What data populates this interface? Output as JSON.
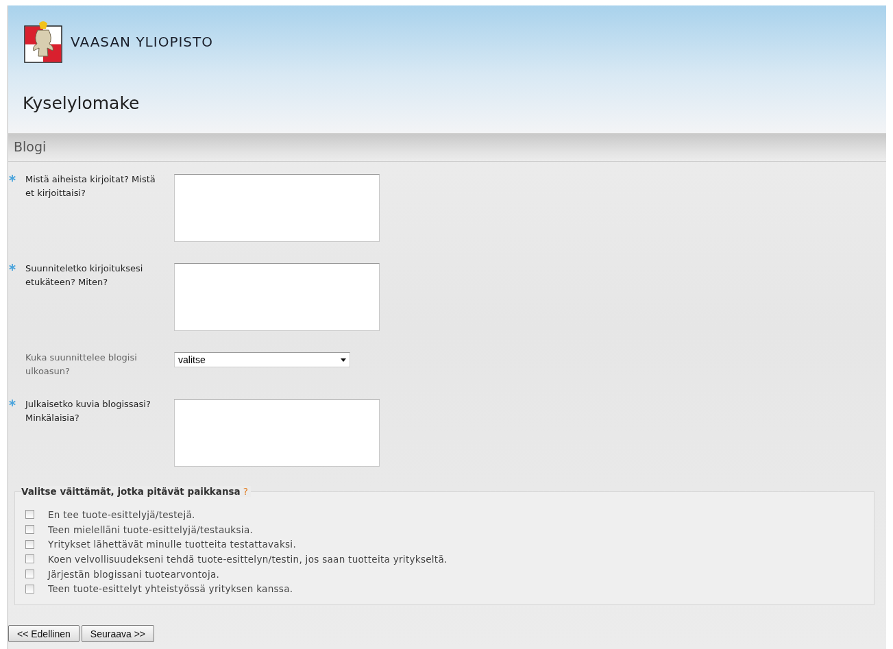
{
  "header": {
    "brand": "VAASAN YLIOPISTO",
    "title": "Kyselylomake"
  },
  "section": {
    "title": "Blogi"
  },
  "questions": [
    {
      "kind": "textarea",
      "required": true,
      "label": "Mistä aiheista kirjoitat? Mistä et kirjoittaisi?"
    },
    {
      "kind": "textarea",
      "required": true,
      "label": "Suunniteletko kirjoituksesi etukäteen? Miten?"
    },
    {
      "kind": "select",
      "required": false,
      "label": "Kuka suunnittelee blogisi ulkoasun?",
      "value": "valitse"
    },
    {
      "kind": "textarea",
      "required": true,
      "label": "Julkaisetko kuvia blogissasi? Minkälaisia?"
    }
  ],
  "statements": {
    "legend": "Valitse väittämät, jotka pitävät paikkansa",
    "help": "?",
    "items": [
      {
        "label": "En tee tuote-esittelyjä/testejä.",
        "checked": false
      },
      {
        "label": "Teen mielelläni tuote-esittelyjä/testauksia.",
        "checked": false
      },
      {
        "label": "Yritykset lähettävät minulle tuotteita testattavaksi.",
        "checked": false
      },
      {
        "label": "Koen velvollisuudekseni tehdä tuote-esittelyn/testin, jos saan tuotteita yritykseltä.",
        "checked": false
      },
      {
        "label": "Järjestän blogissani tuotearvontoja.",
        "checked": false
      },
      {
        "label": "Teen tuote-esittelyt yhteistyössä yrityksen kanssa.",
        "checked": false
      }
    ]
  },
  "buttons": [
    {
      "label": "<< Edellinen"
    },
    {
      "label": "Seuraava >>"
    }
  ]
}
